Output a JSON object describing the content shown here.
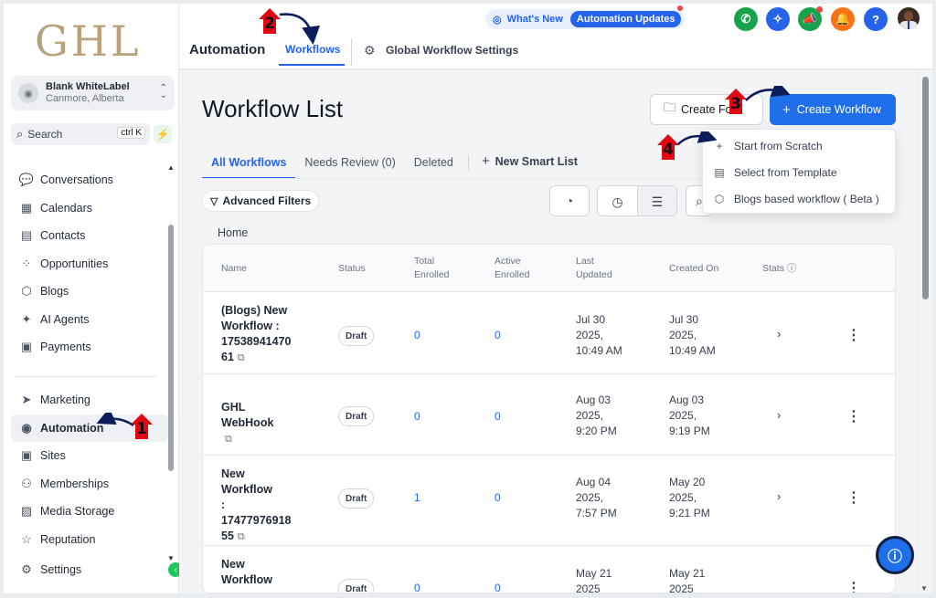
{
  "logo": "GHL",
  "account": {
    "name": "Blank WhiteLabel",
    "location": "Canmore, Alberta"
  },
  "search": {
    "label": "Search",
    "shortcut": "ctrl K"
  },
  "sidebar": {
    "items": [
      {
        "label": "Conversations",
        "icon": "chat-bubble-icon"
      },
      {
        "label": "Calendars",
        "icon": "calendar-icon"
      },
      {
        "label": "Contacts",
        "icon": "contacts-icon"
      },
      {
        "label": "Opportunities",
        "icon": "funnel-icon"
      },
      {
        "label": "Blogs",
        "icon": "cube-icon"
      },
      {
        "label": "AI Agents",
        "icon": "sparkle-icon"
      },
      {
        "label": "Payments",
        "icon": "receipt-icon"
      }
    ],
    "items2": [
      {
        "label": "Marketing",
        "icon": "send-icon"
      },
      {
        "label": "Automation",
        "icon": "play-circle-icon",
        "active": true
      },
      {
        "label": "Sites",
        "icon": "globe-icon"
      },
      {
        "label": "Memberships",
        "icon": "membership-icon"
      },
      {
        "label": "Media Storage",
        "icon": "image-icon"
      },
      {
        "label": "Reputation",
        "icon": "star-icon"
      },
      {
        "label": "Settings",
        "icon": "gear-icon"
      }
    ]
  },
  "header": {
    "title": "Automation",
    "tab_workflows": "Workflows",
    "tab_global": "Global Workflow Settings",
    "whats_new": "What's New",
    "automation_updates": "Automation Updates"
  },
  "page": {
    "title": "Workflow List",
    "create_folder": "Create Fo",
    "create_workflow": "Create Workflow",
    "tabs": [
      "All Workflows",
      "Needs Review (0)",
      "Deleted"
    ],
    "new_smart_list": "New Smart List",
    "advanced_filters": "Advanced Filters",
    "breadcrumb": "Home"
  },
  "dropdown": {
    "items": [
      {
        "label": "Start from Scratch",
        "icon": "plus-icon"
      },
      {
        "label": "Select from Template",
        "icon": "template-icon"
      },
      {
        "label": "Blogs based workflow ( Beta )",
        "icon": "cube-icon"
      }
    ]
  },
  "table": {
    "headers": {
      "name": "Name",
      "status": "Status",
      "total1": "Total",
      "total2": "Enrolled",
      "active1": "Active",
      "active2": "Enrolled",
      "last1": "Last",
      "last2": "Updated",
      "created": "Created On",
      "stats": "Stats"
    },
    "rows": [
      {
        "name_lines": [
          "(Blogs) New",
          "Workflow :",
          "17538941470",
          "61"
        ],
        "status": "Draft",
        "total": "0",
        "active": "0",
        "updated": [
          "Jul 30",
          "2025,",
          "10:49 AM"
        ],
        "created": [
          "Jul 30",
          "2025,",
          "10:49 AM"
        ]
      },
      {
        "name_lines": [
          "GHL WebHook",
          ""
        ],
        "status": "Draft",
        "total": "0",
        "active": "0",
        "updated": [
          "Aug 03",
          "2025,",
          "9:20 PM"
        ],
        "created": [
          "Aug 03",
          "2025,",
          "9:19 PM"
        ]
      },
      {
        "name_lines": [
          "New Workflow",
          ":",
          "17477976918",
          "55"
        ],
        "status": "Draft",
        "total": "1",
        "active": "0",
        "updated": [
          "Aug 04",
          "2025,",
          "7:57 PM"
        ],
        "created": [
          "May 20",
          "2025,",
          "9:21 PM"
        ]
      },
      {
        "name_lines": [
          "New Workflow",
          ":"
        ],
        "status": "Draft",
        "total": "0",
        "active": "0",
        "updated": [
          "May 21",
          "2025"
        ],
        "created": [
          "May 21",
          "2025"
        ]
      }
    ]
  },
  "annotations": [
    "1",
    "2",
    "3",
    "4"
  ],
  "colors": {
    "accent": "#2563eb",
    "logo": "#b9a27a",
    "annotation": "#e30613"
  }
}
